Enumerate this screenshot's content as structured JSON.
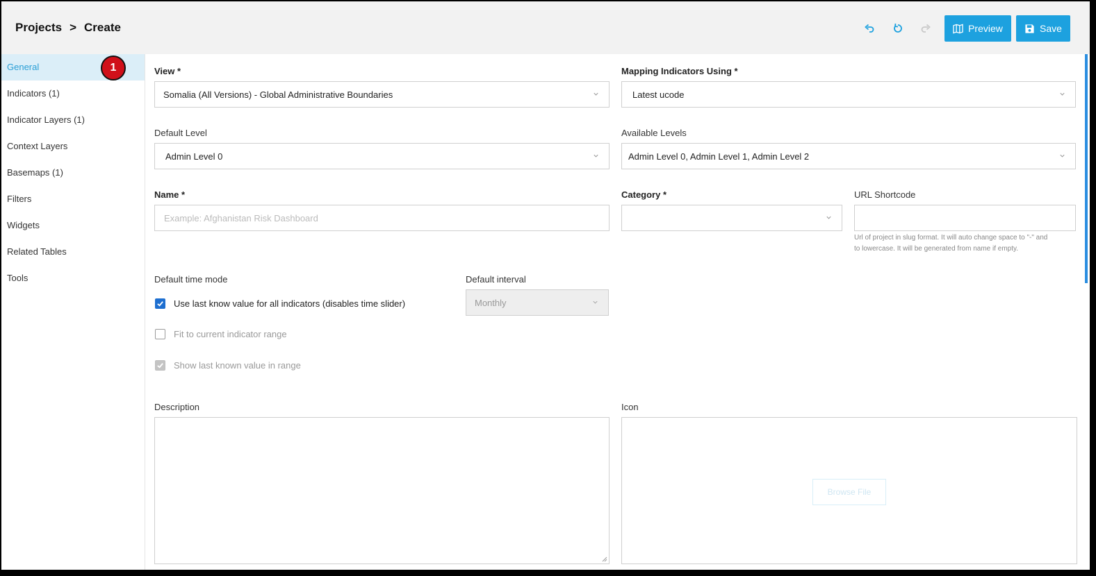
{
  "breadcrumb": {
    "root": "Projects",
    "separator": ">",
    "current": "Create"
  },
  "toolbar": {
    "preview_label": "Preview",
    "save_label": "Save"
  },
  "sidebar": {
    "marker": "1",
    "items": [
      {
        "label": "General"
      },
      {
        "label": "Indicators (1)"
      },
      {
        "label": "Indicator Layers (1)"
      },
      {
        "label": "Context Layers"
      },
      {
        "label": "Basemaps (1)"
      },
      {
        "label": "Filters"
      },
      {
        "label": "Widgets"
      },
      {
        "label": "Related Tables"
      },
      {
        "label": "Tools"
      }
    ]
  },
  "form": {
    "view": {
      "label": "View *",
      "value": "Somalia (All Versions) - Global Administrative Boundaries"
    },
    "mapping": {
      "label": "Mapping Indicators Using *",
      "value": "Latest ucode"
    },
    "default_level": {
      "label": "Default Level",
      "value": "Admin Level 0"
    },
    "available_levels": {
      "label": "Available Levels",
      "value": "Admin Level 0, Admin Level 1, Admin Level 2"
    },
    "name": {
      "label": "Name *",
      "placeholder": "Example: Afghanistan Risk Dashboard"
    },
    "category": {
      "label": "Category *",
      "value": ""
    },
    "url_shortcode": {
      "label": "URL Shortcode",
      "value": "",
      "hint_line1": "Url of project in slug format. It will auto change space to \"-\" and",
      "hint_line2": "to lowercase. It will be generated from name if empty."
    },
    "time_mode": {
      "label": "Default time mode",
      "use_last_value": {
        "label": "Use last know value for all indicators (disables time slider)",
        "checked": true
      },
      "fit_range": {
        "label": "Fit to current indicator range",
        "checked": false
      },
      "show_last_known": {
        "label": "Show last known value in range",
        "checked": true
      }
    },
    "interval": {
      "label": "Default interval",
      "value": "Monthly"
    },
    "description": {
      "label": "Description",
      "value": ""
    },
    "icon": {
      "label": "Icon",
      "browse_label": "Browse File"
    }
  },
  "colors": {
    "accent": "#1da1df",
    "checkbox": "#1e6fd0",
    "marker": "#d0101a"
  }
}
